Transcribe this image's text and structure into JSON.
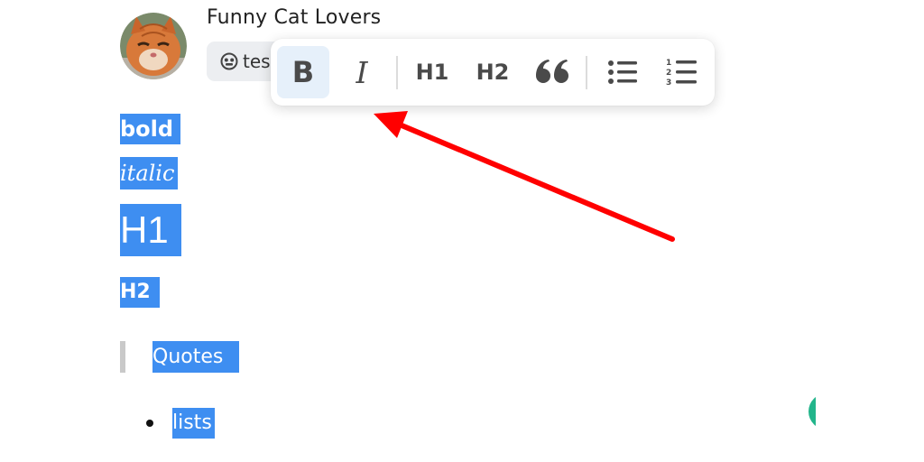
{
  "header": {
    "channel_title": "Funny Cat Lovers",
    "tag_chip": {
      "icon": "emoji-face-icon",
      "text": "tes"
    }
  },
  "toolbar": {
    "items": [
      {
        "name": "bold",
        "label": "B",
        "active": true
      },
      {
        "name": "italic",
        "label": "I",
        "active": false
      },
      {
        "name": "heading-1",
        "label": "H1",
        "active": false
      },
      {
        "name": "heading-2",
        "label": "H2",
        "active": false
      },
      {
        "name": "quote",
        "icon": "quote-icon",
        "active": false
      },
      {
        "name": "bulleted-list",
        "icon": "bulleted-list-icon",
        "active": false
      },
      {
        "name": "numbered-list",
        "icon": "numbered-list-icon",
        "active": false
      }
    ]
  },
  "content": {
    "bold_text": "bold",
    "italic_text": "italic",
    "h1_text": "H1",
    "h2_text": "H2",
    "quote_text": "Quotes",
    "list_items": [
      "lists"
    ]
  },
  "colors": {
    "selection": "#3e8ef1",
    "toolbar_active": "#e6f0fa",
    "annotation_arrow": "#ff0000",
    "edge_button": "#22b58b"
  }
}
